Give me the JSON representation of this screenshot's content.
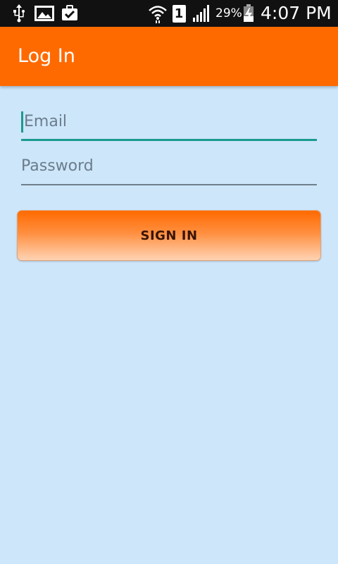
{
  "status_bar": {
    "left_icons": [
      "usb-icon",
      "image-icon",
      "clipboard-check-icon"
    ],
    "right_icons": [
      "wifi-icon",
      "sim-1-icon",
      "signal-icon",
      "battery-charging-icon"
    ],
    "sim_label": "1",
    "battery_percent": "29%",
    "time": "4:07 PM"
  },
  "app_bar": {
    "title": "Log In",
    "background_color": "#ff6a00"
  },
  "form": {
    "email": {
      "placeholder": "Email",
      "value": ""
    },
    "password": {
      "placeholder": "Password",
      "value": ""
    },
    "accent_color": "#1a9b8f"
  },
  "sign_in_button": {
    "label": "SIGN IN"
  }
}
